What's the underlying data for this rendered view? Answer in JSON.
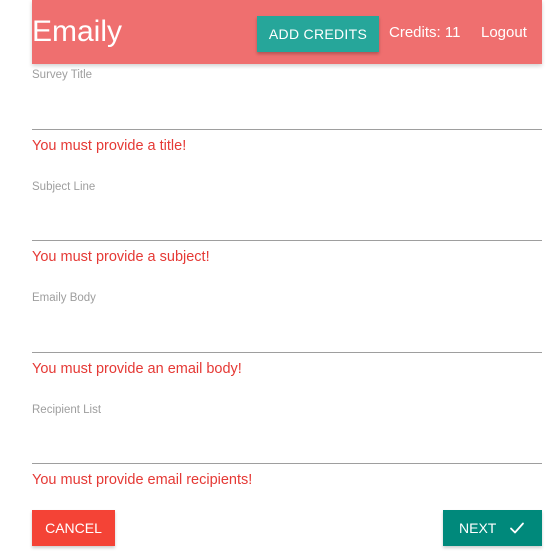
{
  "header": {
    "brand": "Emaily",
    "add_credits_label": "ADD CREDITS",
    "credits_text": "Credits: 11",
    "logout_label": "Logout"
  },
  "form": {
    "fields": [
      {
        "label": "Survey Title",
        "value": "",
        "error": "You must provide a title!"
      },
      {
        "label": "Subject Line",
        "value": "",
        "error": "You must provide a subject!"
      },
      {
        "label": "Emaily Body",
        "value": "",
        "error": "You must provide an email body!"
      },
      {
        "label": "Recipient List",
        "value": "",
        "error": "You must provide email recipients!"
      }
    ],
    "cancel_label": "CANCEL",
    "next_label": "NEXT",
    "next_icon": "check-icon"
  },
  "colors": {
    "navbar": "#ef6f6f",
    "add_credits": "#26a69a",
    "error": "#e53935",
    "cancel": "#f44336",
    "next": "#00897b"
  }
}
